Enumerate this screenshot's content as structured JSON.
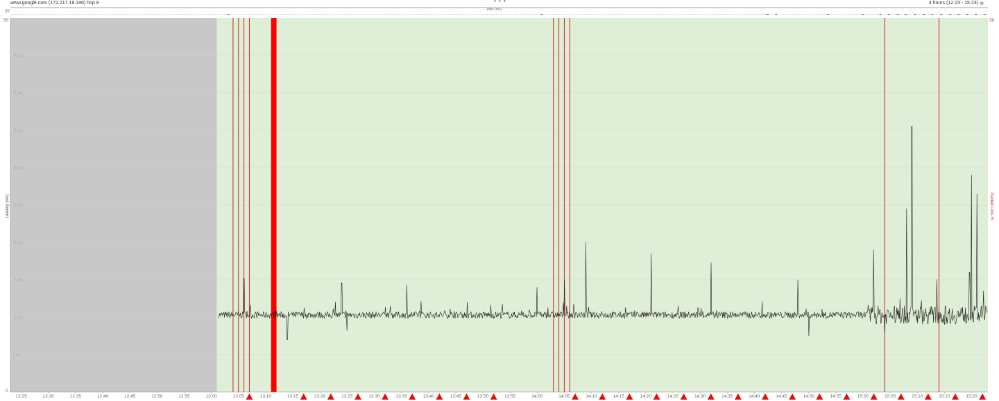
{
  "header": {
    "target": "www.google.com (172.217.19.196) hop 8",
    "time_range": "3 hours (12:23 - 15:23)",
    "more": "• • •"
  },
  "jitter": {
    "label": "Jitter (ms)",
    "scale_max": "35"
  },
  "chart_data": {
    "type": "line",
    "title": "",
    "xlabel": "",
    "ylabel": "Latency (ms)",
    "y2label": "Packet Loss %",
    "ylim": [
      0,
      50
    ],
    "y2lim": [
      0,
      30
    ],
    "y_left_max_label": "50",
    "y_left_min_label": "0",
    "y_right_max_label": "30",
    "yticks": [
      "5 ms",
      "10 ms",
      "15 ms",
      "20 ms",
      "25 ms",
      "30 ms",
      "35 ms",
      "40 ms",
      "45 ms"
    ],
    "xticks": [
      "12:25",
      "12:30",
      "12:35",
      "12:40",
      "12:45",
      "12:50",
      "12:55",
      "13:00",
      "13:05",
      "13:10",
      "13:15",
      "13:20",
      "13:25",
      "13:30",
      "13:35",
      "13:40",
      "13:45",
      "13:50",
      "13:55",
      "14:00",
      "14:05",
      "14:10",
      "14:15",
      "14:20",
      "14:25",
      "14:30",
      "14:35",
      "14:40",
      "14:45",
      "14:50",
      "14:55",
      "15:00",
      "15:05",
      "15:10",
      "15:15",
      "15:20"
    ],
    "x_start": "12:23",
    "x_end": "15:23",
    "no_data_until": "13:01",
    "series": [
      {
        "name": "Latency (ms)",
        "baseline_ms": 10.3,
        "spikes": [
          {
            "time": "13:06",
            "ms": 15.2
          },
          {
            "time": "13:24",
            "ms": 14.6
          },
          {
            "time": "13:25",
            "ms": 17.8
          },
          {
            "time": "13:36",
            "ms": 14.3
          },
          {
            "time": "14:00",
            "ms": 14.0
          },
          {
            "time": "14:05",
            "ms": 15.0
          },
          {
            "time": "14:09",
            "ms": 20.0
          },
          {
            "time": "14:21",
            "ms": 18.5
          },
          {
            "time": "14:32",
            "ms": 17.3
          },
          {
            "time": "14:48",
            "ms": 15.0
          },
          {
            "time": "14:50",
            "ms": 18.0
          },
          {
            "time": "15:02",
            "ms": 19.0
          },
          {
            "time": "15:04",
            "ms": 22.5
          },
          {
            "time": "15:08",
            "ms": 24.5
          },
          {
            "time": "15:09",
            "ms": 35.5
          },
          {
            "time": "15:15",
            "ms": 27.0
          },
          {
            "time": "15:20",
            "ms": 29.0
          },
          {
            "time": "15:21",
            "ms": 26.5
          }
        ],
        "dips": [
          {
            "time": "13:14",
            "ms": 7.0
          },
          {
            "time": "13:25",
            "ms": 8.2
          },
          {
            "time": "14:50",
            "ms": 7.5
          },
          {
            "time": "15:04",
            "ms": 8.0
          },
          {
            "time": "15:15",
            "ms": 9.0
          }
        ]
      }
    ],
    "packet_loss_events": [
      {
        "time": "13:04"
      },
      {
        "time": "13:05"
      },
      {
        "time": "13:06"
      },
      {
        "time": "13:07"
      },
      {
        "start": "13:11",
        "end": "13:12"
      },
      {
        "time": "14:03"
      },
      {
        "time": "14:04"
      },
      {
        "time": "14:05"
      },
      {
        "time": "14:06"
      },
      {
        "time": "15:04"
      },
      {
        "time": "15:14"
      }
    ],
    "alert_markers": [
      "13:07",
      "13:17",
      "13:22",
      "13:27",
      "13:32",
      "13:37",
      "13:42",
      "13:47",
      "13:52",
      "14:07",
      "14:12",
      "14:17",
      "14:22",
      "14:27",
      "14:32",
      "14:37",
      "14:42",
      "14:47",
      "14:52",
      "14:57",
      "15:02",
      "15:07",
      "15:12",
      "15:17",
      "15:22"
    ],
    "colors": {
      "plot_ok": "#dfeed6",
      "plot_nodata": "#c8c8c8",
      "latency_line": "#1c1c1c",
      "packet_loss": "#ff0000",
      "loss_line": "#cc2222",
      "alert": "#e01010",
      "grid": "#cfdbc7"
    }
  }
}
